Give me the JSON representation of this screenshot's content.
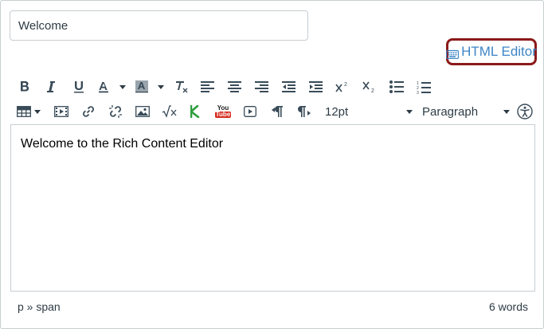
{
  "title_input": {
    "value": "Welcome"
  },
  "html_editor_link": {
    "label": "HTML Editor"
  },
  "toolbar": {
    "font_size": "12pt",
    "block_format": "Paragraph",
    "youtube_top": "You",
    "youtube_bottom": "Tube"
  },
  "content": {
    "text": "Welcome to the Rich Content Editor"
  },
  "status_bar": {
    "path": "p » span",
    "word_count": "6 words"
  },
  "colors": {
    "link": "#3d85c6",
    "highlight_border": "#8b1a1a",
    "kaltura_green": "#2e9e3e",
    "youtube_red": "#d52b1e"
  }
}
